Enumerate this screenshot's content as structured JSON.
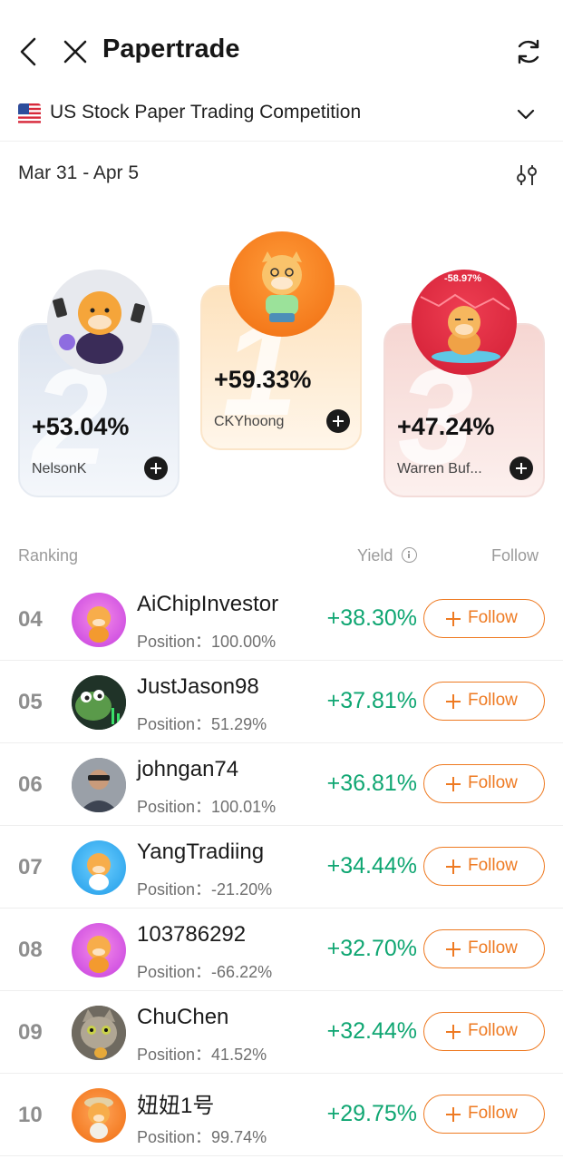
{
  "header": {
    "title": "Papertrade",
    "back_icon": "chevron-left-icon",
    "close_icon": "close-icon",
    "refresh_icon": "refresh-icon"
  },
  "competition": {
    "flag": "us-flag-icon",
    "label": "US Stock Paper Trading Competition",
    "dropdown_icon": "chevron-down-icon"
  },
  "period": {
    "date_range": "Mar 31 - Apr 5",
    "filter_icon": "sliders-icon"
  },
  "podium": [
    {
      "place": "2",
      "yield": "+53.04%",
      "name": "NelsonK",
      "avatar_color": "#e7e9ee"
    },
    {
      "place": "1",
      "yield": "+59.33%",
      "name": "CKYhoong",
      "avatar_color": "#f47c1c"
    },
    {
      "place": "3",
      "yield": "+47.24%",
      "name": "Warren Buf...",
      "avatar_color": "#dd2a40",
      "avatar_caption": "-58.97%"
    }
  ],
  "table_header": {
    "ranking": "Ranking",
    "yield": "Yield",
    "follow": "Follow"
  },
  "rows": [
    {
      "rank": "04",
      "name": "AiChipInvestor",
      "position_label": "Position：",
      "position": "100.00%",
      "yield": "+38.30%",
      "follow_label": "Follow"
    },
    {
      "rank": "05",
      "name": "JustJason98",
      "position_label": "Position：",
      "position": "51.29%",
      "yield": "+37.81%",
      "follow_label": "Follow"
    },
    {
      "rank": "06",
      "name": "johngan74",
      "position_label": "Position：",
      "position": "100.01%",
      "yield": "+36.81%",
      "follow_label": "Follow"
    },
    {
      "rank": "07",
      "name": "YangTradiing",
      "position_label": "Position：",
      "position": "-21.20%",
      "yield": "+34.44%",
      "follow_label": "Follow"
    },
    {
      "rank": "08",
      "name": "103786292",
      "position_label": "Position：",
      "position": "-66.22%",
      "yield": "+32.70%",
      "follow_label": "Follow"
    },
    {
      "rank": "09",
      "name": "ChuChen",
      "position_label": "Position：",
      "position": "41.52%",
      "yield": "+32.44%",
      "follow_label": "Follow"
    },
    {
      "rank": "10",
      "name": "妞妞1号",
      "position_label": "Position：",
      "position": "99.74%",
      "yield": "+29.75%",
      "follow_label": "Follow"
    }
  ],
  "colors": {
    "accent": "#ee7a22",
    "gain": "#0fa672"
  }
}
